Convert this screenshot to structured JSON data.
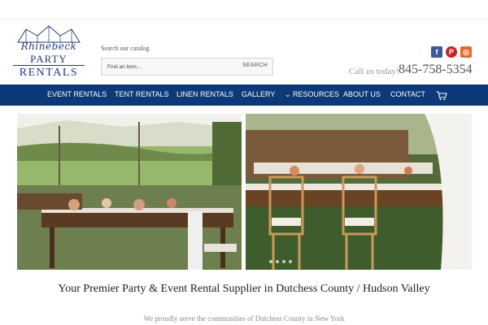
{
  "header": {
    "logo": {
      "line1": "Rhinebeck",
      "line2": "PARTY",
      "line3": "RENTALS"
    },
    "search": {
      "label": "Search our catalog",
      "placeholder": "Find an item...",
      "button_label": "SEARCH"
    },
    "social": [
      {
        "name": "facebook-icon",
        "glyph": "f",
        "color": "#3b5998"
      },
      {
        "name": "pinterest-icon",
        "glyph": "P",
        "color": "#cb2027"
      },
      {
        "name": "instagram-icon",
        "glyph": "◎",
        "color": "#e8682a"
      }
    ],
    "call_label": "Call us today!",
    "phone": "845-758-5354"
  },
  "nav": {
    "items": [
      {
        "label": "EVENT RENTALS"
      },
      {
        "label": "TENT RENTALS"
      },
      {
        "label": "LINEN RENTALS"
      },
      {
        "label": "GALLERY"
      },
      {
        "label": "⌄ RESOURCES"
      },
      {
        "label": "ABOUT US"
      },
      {
        "label": "CONTACT"
      }
    ],
    "cart_icon": "shopping-cart-icon",
    "background": "#0c3978"
  },
  "hero": {
    "slide_count": 4
  },
  "main": {
    "headline": "Your Premier Party & Event Rental Supplier in Dutchess County / Hudson Valley",
    "subline": "We proudly serve the communities of Dutchess County in New York"
  }
}
